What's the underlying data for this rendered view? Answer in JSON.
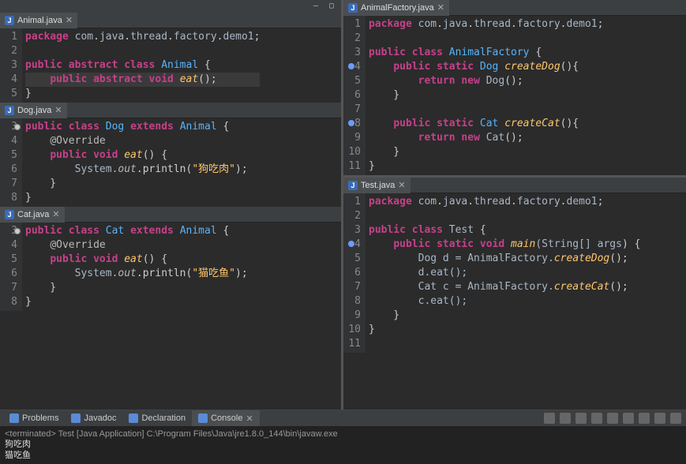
{
  "window_buttons": {
    "min": "—",
    "max": "▢"
  },
  "left": {
    "animal": {
      "tab": "Animal.java",
      "lines": [
        [
          {
            "t": "package ",
            "c": "kw"
          },
          {
            "t": "com",
            "c": "var"
          },
          {
            "t": ".",
            "c": "pun"
          },
          {
            "t": "java",
            "c": "var"
          },
          {
            "t": ".",
            "c": "pun"
          },
          {
            "t": "thread",
            "c": "var"
          },
          {
            "t": ".",
            "c": "pun"
          },
          {
            "t": "factory",
            "c": "var"
          },
          {
            "t": ".",
            "c": "pun"
          },
          {
            "t": "demo1",
            "c": "var"
          },
          {
            "t": ";",
            "c": "pun"
          }
        ],
        [],
        [
          {
            "t": "public abstract class ",
            "c": "kw"
          },
          {
            "t": "Animal",
            "c": "cls"
          },
          {
            "t": " {",
            "c": "pun"
          }
        ],
        [
          {
            "t": "    ",
            "c": ""
          },
          {
            "t": "public abstract void ",
            "c": "kw"
          },
          {
            "t": "eat",
            "c": "mt"
          },
          {
            "t": "();",
            "c": "pun"
          }
        ],
        [
          {
            "t": "}",
            "c": "pun"
          }
        ]
      ],
      "linenos": [
        "1",
        "2",
        "3",
        "4",
        "5"
      ],
      "hl": 3
    },
    "dog": {
      "tab": "Dog.java",
      "lines": [
        [
          {
            "t": "public class ",
            "c": "kw"
          },
          {
            "t": "Dog",
            "c": "cls"
          },
          {
            "t": " ",
            "c": ""
          },
          {
            "t": "extends",
            "c": "kw"
          },
          {
            "t": " ",
            "c": ""
          },
          {
            "t": "Animal",
            "c": "cls"
          },
          {
            "t": " {",
            "c": "pun"
          }
        ],
        [
          {
            "t": "    ",
            "c": ""
          },
          {
            "t": "@Override",
            "c": "ann"
          }
        ],
        [
          {
            "t": "    ",
            "c": ""
          },
          {
            "t": "public void ",
            "c": "kw"
          },
          {
            "t": "eat",
            "c": "mt"
          },
          {
            "t": "() {",
            "c": "pun"
          }
        ],
        [
          {
            "t": "        System.",
            "c": "var"
          },
          {
            "t": "out",
            "c": "fld"
          },
          {
            "t": ".println(",
            "c": "pun"
          },
          {
            "t": "\"狗吃肉\"",
            "c": "str"
          },
          {
            "t": ");",
            "c": "pun"
          }
        ],
        [
          {
            "t": "    }",
            "c": "pun"
          }
        ],
        [
          {
            "t": "}",
            "c": "pun"
          }
        ]
      ],
      "linenos": [
        "3",
        "4",
        "5",
        "6",
        "7",
        "8"
      ],
      "ovr": 0
    },
    "cat": {
      "tab": "Cat.java",
      "lines": [
        [
          {
            "t": "public class ",
            "c": "kw"
          },
          {
            "t": "Cat",
            "c": "cls"
          },
          {
            "t": " ",
            "c": ""
          },
          {
            "t": "extends",
            "c": "kw"
          },
          {
            "t": " ",
            "c": ""
          },
          {
            "t": "Animal",
            "c": "cls"
          },
          {
            "t": " {",
            "c": "pun"
          }
        ],
        [
          {
            "t": "    ",
            "c": ""
          },
          {
            "t": "@Override",
            "c": "ann"
          }
        ],
        [
          {
            "t": "    ",
            "c": ""
          },
          {
            "t": "public void ",
            "c": "kw"
          },
          {
            "t": "eat",
            "c": "mt"
          },
          {
            "t": "() {",
            "c": "pun"
          }
        ],
        [
          {
            "t": "        System.",
            "c": "var"
          },
          {
            "t": "out",
            "c": "fld"
          },
          {
            "t": ".println(",
            "c": "pun"
          },
          {
            "t": "\"猫吃鱼\"",
            "c": "str"
          },
          {
            "t": ");",
            "c": "pun"
          }
        ],
        [
          {
            "t": "    }",
            "c": "pun"
          }
        ],
        [
          {
            "t": "}",
            "c": "pun"
          }
        ]
      ],
      "linenos": [
        "3",
        "4",
        "5",
        "6",
        "7",
        "8"
      ],
      "ovr": 0
    }
  },
  "right": {
    "factory": {
      "tab": "AnimalFactory.java",
      "lines": [
        [
          {
            "t": "package ",
            "c": "kw"
          },
          {
            "t": "com",
            "c": "var"
          },
          {
            "t": ".",
            "c": "pun"
          },
          {
            "t": "java",
            "c": "var"
          },
          {
            "t": ".",
            "c": "pun"
          },
          {
            "t": "thread",
            "c": "var"
          },
          {
            "t": ".",
            "c": "pun"
          },
          {
            "t": "factory",
            "c": "var"
          },
          {
            "t": ".",
            "c": "pun"
          },
          {
            "t": "demo1",
            "c": "var"
          },
          {
            "t": ";",
            "c": "pun"
          }
        ],
        [],
        [
          {
            "t": "public class ",
            "c": "kw"
          },
          {
            "t": "AnimalFactory",
            "c": "cls"
          },
          {
            "t": " {",
            "c": "pun"
          }
        ],
        [
          {
            "t": "    ",
            "c": ""
          },
          {
            "t": "public static ",
            "c": "kw"
          },
          {
            "t": "Dog",
            "c": "cls"
          },
          {
            "t": " ",
            "c": ""
          },
          {
            "t": "createDog",
            "c": "mt"
          },
          {
            "t": "(){",
            "c": "pun"
          }
        ],
        [
          {
            "t": "        ",
            "c": ""
          },
          {
            "t": "return new ",
            "c": "kw"
          },
          {
            "t": "Dog",
            "c": "var"
          },
          {
            "t": "();",
            "c": "pun"
          }
        ],
        [
          {
            "t": "    }",
            "c": "pun"
          }
        ],
        [],
        [
          {
            "t": "    ",
            "c": ""
          },
          {
            "t": "public static ",
            "c": "kw"
          },
          {
            "t": "Cat",
            "c": "cls"
          },
          {
            "t": " ",
            "c": ""
          },
          {
            "t": "createCat",
            "c": "mt"
          },
          {
            "t": "(){",
            "c": "pun"
          }
        ],
        [
          {
            "t": "        ",
            "c": ""
          },
          {
            "t": "return new ",
            "c": "kw"
          },
          {
            "t": "Cat",
            "c": "var"
          },
          {
            "t": "();",
            "c": "pun"
          }
        ],
        [
          {
            "t": "    }",
            "c": "pun"
          }
        ],
        [
          {
            "t": "}",
            "c": "pun"
          }
        ]
      ],
      "linenos": [
        "1",
        "2",
        "3",
        "4",
        "5",
        "6",
        "7",
        "8",
        "9",
        "10",
        "11"
      ],
      "bpcols": [
        3,
        7
      ]
    },
    "test": {
      "tab": "Test.java",
      "lines": [
        [
          {
            "t": "package ",
            "c": "kw"
          },
          {
            "t": "com",
            "c": "var"
          },
          {
            "t": ".",
            "c": "pun"
          },
          {
            "t": "java",
            "c": "var"
          },
          {
            "t": ".",
            "c": "pun"
          },
          {
            "t": "thread",
            "c": "var"
          },
          {
            "t": ".",
            "c": "pun"
          },
          {
            "t": "factory",
            "c": "var"
          },
          {
            "t": ".",
            "c": "pun"
          },
          {
            "t": "demo1",
            "c": "var"
          },
          {
            "t": ";",
            "c": "pun"
          }
        ],
        [],
        [
          {
            "t": "public class ",
            "c": "kw"
          },
          {
            "t": "Test",
            "c": "var"
          },
          {
            "t": " {",
            "c": "pun"
          }
        ],
        [
          {
            "t": "    ",
            "c": ""
          },
          {
            "t": "public static void ",
            "c": "kw"
          },
          {
            "t": "main",
            "c": "mt"
          },
          {
            "t": "(String[] ",
            "c": "var"
          },
          {
            "t": "args",
            "c": "var"
          },
          {
            "t": ") {",
            "c": "pun"
          }
        ],
        [
          {
            "t": "        Dog ",
            "c": "var"
          },
          {
            "t": "d",
            "c": "var"
          },
          {
            "t": " = AnimalFactory.",
            "c": "var"
          },
          {
            "t": "createDog",
            "c": "mt"
          },
          {
            "t": "();",
            "c": "pun"
          }
        ],
        [
          {
            "t": "        d.eat();",
            "c": "var"
          }
        ],
        [
          {
            "t": "        Cat ",
            "c": "var"
          },
          {
            "t": "c",
            "c": "var"
          },
          {
            "t": " = AnimalFactory.",
            "c": "var"
          },
          {
            "t": "createCat",
            "c": "mt"
          },
          {
            "t": "();",
            "c": "pun"
          }
        ],
        [
          {
            "t": "        c.eat();",
            "c": "var"
          }
        ],
        [
          {
            "t": "    }",
            "c": "pun"
          }
        ],
        [
          {
            "t": "}",
            "c": "pun"
          }
        ],
        []
      ],
      "linenos": [
        "1",
        "2",
        "3",
        "4",
        "5",
        "6",
        "7",
        "8",
        "9",
        "10",
        "11"
      ],
      "bpcols": [
        3
      ]
    }
  },
  "bottom": {
    "tabs": [
      "Problems",
      "Javadoc",
      "Declaration",
      "Console"
    ],
    "active": 3,
    "terminated": "<terminated> Test [Java Application] C:\\Program Files\\Java\\jre1.8.0_144\\bin\\javaw.exe",
    "output": [
      "狗吃肉",
      "猫吃鱼"
    ]
  }
}
